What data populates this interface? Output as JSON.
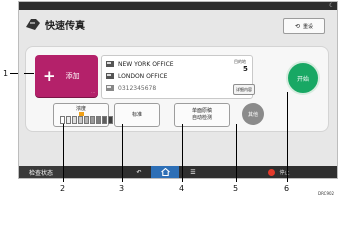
{
  "app": {
    "title": "快速传真",
    "reset_label": "重设"
  },
  "add_button": {
    "label": "添加"
  },
  "destinations": [
    {
      "text": "NEW YORK OFFICE"
    },
    {
      "text": "LONDON OFFICE"
    },
    {
      "text": "0312345678"
    }
  ],
  "destination_count": {
    "label": "目的地",
    "value": "5"
  },
  "detail_button": {
    "label": "详细内容"
  },
  "start_button": {
    "label": "开始"
  },
  "options": {
    "density_label": "浓度",
    "resolution_label": "标准",
    "original_line1": "单面原稿",
    "original_line2": "自动检测",
    "other_label": "其他"
  },
  "bottom_bar": {
    "check_status_label": "检查状态",
    "stop_label": "停止"
  },
  "callouts": [
    "1",
    "2",
    "3",
    "4",
    "5",
    "6"
  ],
  "figure_code": "DRC902",
  "colors": {
    "add_button": "#b4216a",
    "start_button": "#18a864",
    "home_button": "#2d6fb6",
    "stop_dot": "#e43a2b",
    "density_marker": "#f0a018"
  }
}
